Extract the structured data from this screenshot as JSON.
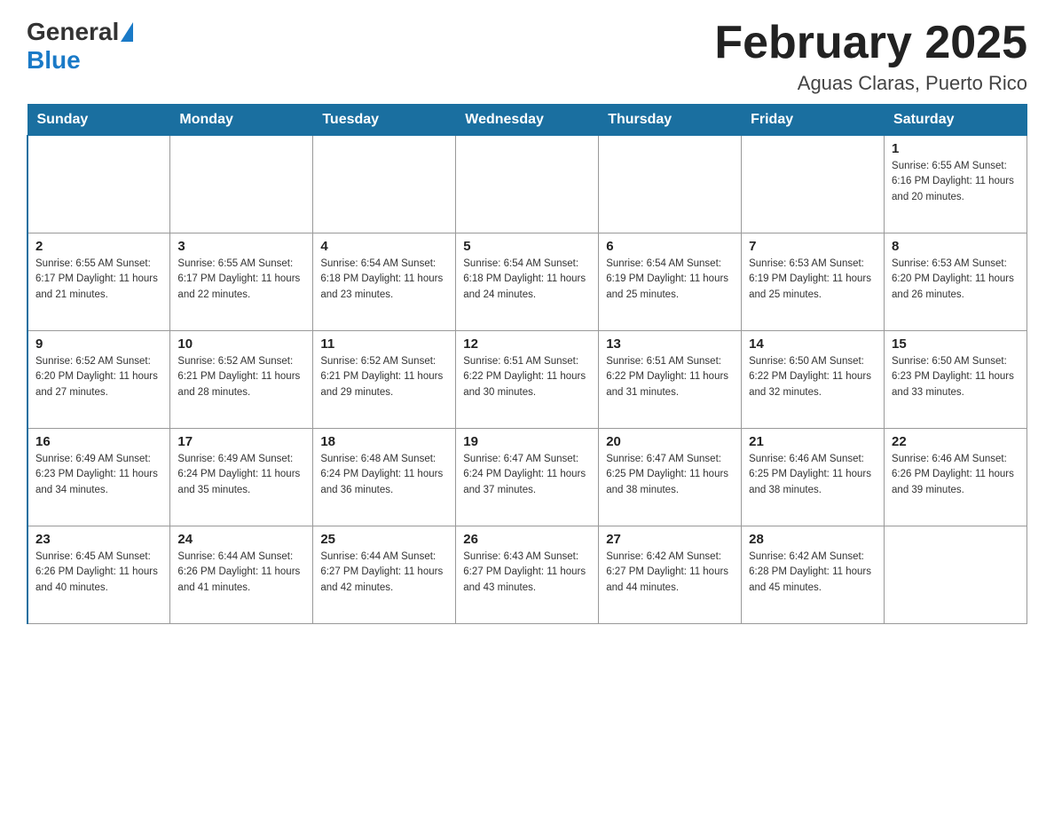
{
  "header": {
    "logo": {
      "general": "General",
      "blue": "Blue"
    },
    "title": "February 2025",
    "location": "Aguas Claras, Puerto Rico"
  },
  "weekdays": [
    "Sunday",
    "Monday",
    "Tuesday",
    "Wednesday",
    "Thursday",
    "Friday",
    "Saturday"
  ],
  "weeks": [
    [
      {
        "day": "",
        "info": ""
      },
      {
        "day": "",
        "info": ""
      },
      {
        "day": "",
        "info": ""
      },
      {
        "day": "",
        "info": ""
      },
      {
        "day": "",
        "info": ""
      },
      {
        "day": "",
        "info": ""
      },
      {
        "day": "1",
        "info": "Sunrise: 6:55 AM\nSunset: 6:16 PM\nDaylight: 11 hours\nand 20 minutes."
      }
    ],
    [
      {
        "day": "2",
        "info": "Sunrise: 6:55 AM\nSunset: 6:17 PM\nDaylight: 11 hours\nand 21 minutes."
      },
      {
        "day": "3",
        "info": "Sunrise: 6:55 AM\nSunset: 6:17 PM\nDaylight: 11 hours\nand 22 minutes."
      },
      {
        "day": "4",
        "info": "Sunrise: 6:54 AM\nSunset: 6:18 PM\nDaylight: 11 hours\nand 23 minutes."
      },
      {
        "day": "5",
        "info": "Sunrise: 6:54 AM\nSunset: 6:18 PM\nDaylight: 11 hours\nand 24 minutes."
      },
      {
        "day": "6",
        "info": "Sunrise: 6:54 AM\nSunset: 6:19 PM\nDaylight: 11 hours\nand 25 minutes."
      },
      {
        "day": "7",
        "info": "Sunrise: 6:53 AM\nSunset: 6:19 PM\nDaylight: 11 hours\nand 25 minutes."
      },
      {
        "day": "8",
        "info": "Sunrise: 6:53 AM\nSunset: 6:20 PM\nDaylight: 11 hours\nand 26 minutes."
      }
    ],
    [
      {
        "day": "9",
        "info": "Sunrise: 6:52 AM\nSunset: 6:20 PM\nDaylight: 11 hours\nand 27 minutes."
      },
      {
        "day": "10",
        "info": "Sunrise: 6:52 AM\nSunset: 6:21 PM\nDaylight: 11 hours\nand 28 minutes."
      },
      {
        "day": "11",
        "info": "Sunrise: 6:52 AM\nSunset: 6:21 PM\nDaylight: 11 hours\nand 29 minutes."
      },
      {
        "day": "12",
        "info": "Sunrise: 6:51 AM\nSunset: 6:22 PM\nDaylight: 11 hours\nand 30 minutes."
      },
      {
        "day": "13",
        "info": "Sunrise: 6:51 AM\nSunset: 6:22 PM\nDaylight: 11 hours\nand 31 minutes."
      },
      {
        "day": "14",
        "info": "Sunrise: 6:50 AM\nSunset: 6:22 PM\nDaylight: 11 hours\nand 32 minutes."
      },
      {
        "day": "15",
        "info": "Sunrise: 6:50 AM\nSunset: 6:23 PM\nDaylight: 11 hours\nand 33 minutes."
      }
    ],
    [
      {
        "day": "16",
        "info": "Sunrise: 6:49 AM\nSunset: 6:23 PM\nDaylight: 11 hours\nand 34 minutes."
      },
      {
        "day": "17",
        "info": "Sunrise: 6:49 AM\nSunset: 6:24 PM\nDaylight: 11 hours\nand 35 minutes."
      },
      {
        "day": "18",
        "info": "Sunrise: 6:48 AM\nSunset: 6:24 PM\nDaylight: 11 hours\nand 36 minutes."
      },
      {
        "day": "19",
        "info": "Sunrise: 6:47 AM\nSunset: 6:24 PM\nDaylight: 11 hours\nand 37 minutes."
      },
      {
        "day": "20",
        "info": "Sunrise: 6:47 AM\nSunset: 6:25 PM\nDaylight: 11 hours\nand 38 minutes."
      },
      {
        "day": "21",
        "info": "Sunrise: 6:46 AM\nSunset: 6:25 PM\nDaylight: 11 hours\nand 38 minutes."
      },
      {
        "day": "22",
        "info": "Sunrise: 6:46 AM\nSunset: 6:26 PM\nDaylight: 11 hours\nand 39 minutes."
      }
    ],
    [
      {
        "day": "23",
        "info": "Sunrise: 6:45 AM\nSunset: 6:26 PM\nDaylight: 11 hours\nand 40 minutes."
      },
      {
        "day": "24",
        "info": "Sunrise: 6:44 AM\nSunset: 6:26 PM\nDaylight: 11 hours\nand 41 minutes."
      },
      {
        "day": "25",
        "info": "Sunrise: 6:44 AM\nSunset: 6:27 PM\nDaylight: 11 hours\nand 42 minutes."
      },
      {
        "day": "26",
        "info": "Sunrise: 6:43 AM\nSunset: 6:27 PM\nDaylight: 11 hours\nand 43 minutes."
      },
      {
        "day": "27",
        "info": "Sunrise: 6:42 AM\nSunset: 6:27 PM\nDaylight: 11 hours\nand 44 minutes."
      },
      {
        "day": "28",
        "info": "Sunrise: 6:42 AM\nSunset: 6:28 PM\nDaylight: 11 hours\nand 45 minutes."
      },
      {
        "day": "",
        "info": ""
      }
    ]
  ]
}
